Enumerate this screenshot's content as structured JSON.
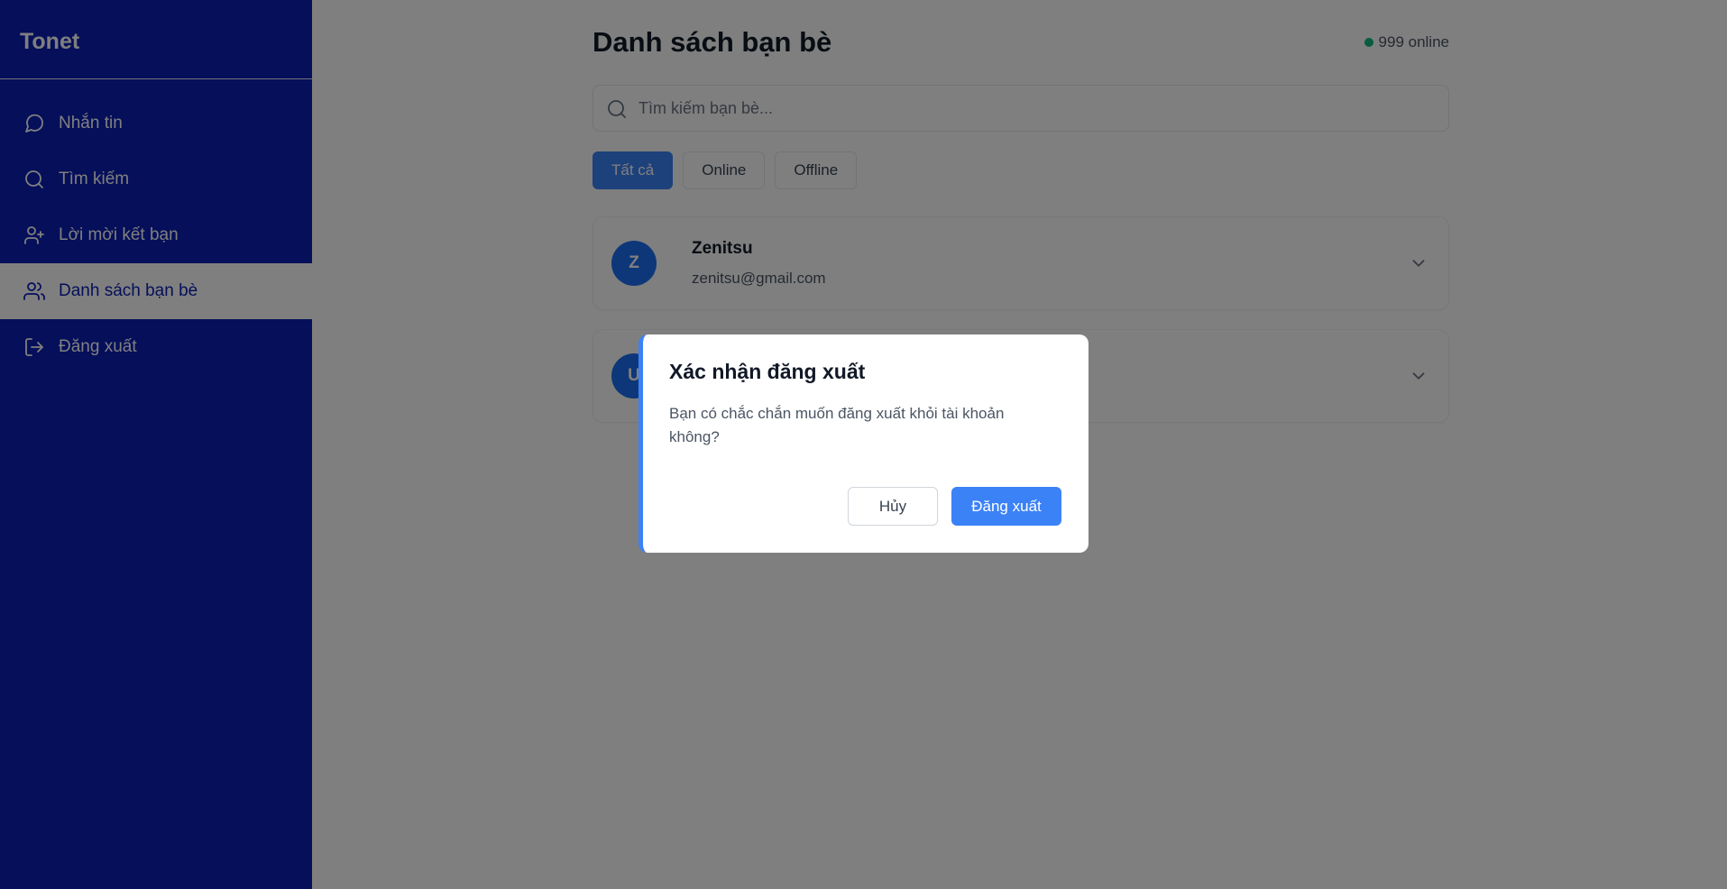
{
  "sidebar": {
    "brand": "Tonet",
    "items": [
      {
        "label": "Nhắn tin",
        "icon": "message-circle-icon"
      },
      {
        "label": "Tìm kiếm",
        "icon": "search-icon"
      },
      {
        "label": "Lời mời kết bạn",
        "icon": "user-plus-icon"
      },
      {
        "label": "Danh sách bạn bè",
        "icon": "users-icon",
        "active": true
      },
      {
        "label": "Đăng xuất",
        "icon": "log-out-icon"
      }
    ]
  },
  "header": {
    "title": "Danh sách bạn bè",
    "online_status": "999 online"
  },
  "search": {
    "placeholder": "Tìm kiếm bạn bè..."
  },
  "filters": [
    {
      "label": "Tất cả",
      "active": true
    },
    {
      "label": "Online"
    },
    {
      "label": "Offline"
    }
  ],
  "friends": [
    {
      "initial": "Z",
      "name": "Zenitsu",
      "email": "zenitsu@gmail.com"
    },
    {
      "initial": "U",
      "name": "",
      "email": ""
    }
  ],
  "modal": {
    "title": "Xác nhận đăng xuất",
    "message": "Bạn có chắc chắn muốn đăng xuất khỏi tài khoản không?",
    "cancel_label": "Hủy",
    "confirm_label": "Đăng xuất"
  },
  "colors": {
    "sidebar_bg": "#0a1eb4",
    "accent": "#3b82f6",
    "avatar": "#1d6ff2",
    "online": "#10b981"
  }
}
